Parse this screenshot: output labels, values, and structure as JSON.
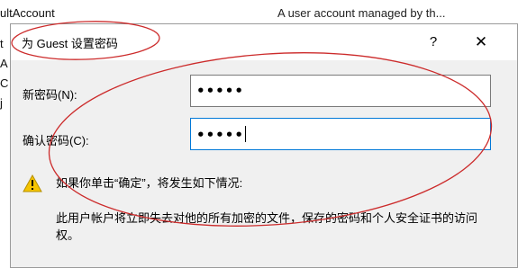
{
  "background": {
    "account_name_fragment": "ultAccount",
    "account_desc": "A user account managed by th...",
    "side_fragments": [
      "t",
      "A",
      "C",
      "j"
    ]
  },
  "dialog": {
    "title": "为 Guest 设置密码",
    "help_label": "?",
    "close_label": "✕",
    "new_password_label": "新密码(N):",
    "new_password_value": "•••••",
    "confirm_password_label": "确认密码(C):",
    "confirm_password_value": "•••••",
    "warning_title": "如果你单击“确定”，将发生如下情况:",
    "warning_body": "此用户帐户将立即失去对他的所有加密的文件，保存的密码和个人安全证书的访问权。"
  },
  "colors": {
    "dialog_bg": "#f0f0f0",
    "annotation_red": "#cc2b2b",
    "focus_blue": "#0078d7",
    "warning_yellow": "#f5c400"
  },
  "icons": {
    "warning": "warning-icon",
    "close": "close-icon",
    "help": "help-icon"
  }
}
